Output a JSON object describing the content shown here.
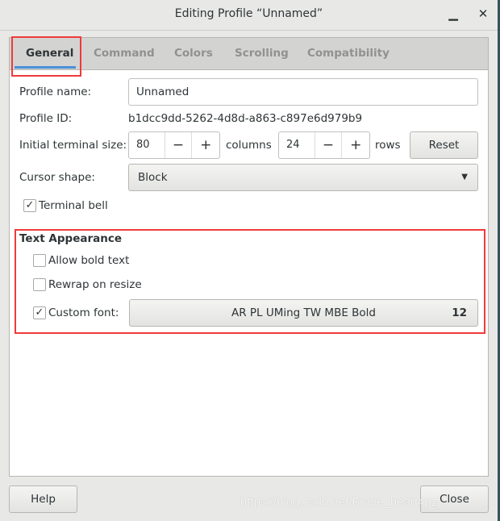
{
  "window": {
    "title": "Editing Profile “Unnamed”",
    "minimize_icon": "minimize-icon",
    "close_icon": "close-icon"
  },
  "tabs": [
    {
      "label": "General",
      "active": true
    },
    {
      "label": "Command"
    },
    {
      "label": "Colors"
    },
    {
      "label": "Scrolling"
    },
    {
      "label": "Compatibility"
    }
  ],
  "general": {
    "profile_name_label": "Profile name:",
    "profile_name_value": "Unnamed",
    "profile_id_label": "Profile ID:",
    "profile_id_value": "b1dcc9dd-5262-4d8d-a863-c897e6d979b9",
    "size_label": "Initial terminal size:",
    "columns_value": "80",
    "columns_label": "columns",
    "rows_value": "24",
    "rows_label": "rows",
    "minus": "−",
    "plus": "+",
    "reset_label": "Reset",
    "cursor_label": "Cursor shape:",
    "cursor_value": "Block",
    "bell_label": "Terminal bell",
    "bell_checked": true
  },
  "text_appearance": {
    "heading": "Text Appearance",
    "bold_label": "Allow bold text",
    "bold_checked": false,
    "rewrap_label": "Rewrap on resize",
    "rewrap_checked": false,
    "custom_font_label": "Custom font:",
    "custom_font_checked": true,
    "font_name": "AR PL UMing TW MBE Bold",
    "font_size": "12"
  },
  "footer": {
    "help_label": "Help",
    "close_label": "Close"
  },
  "watermark": "https://blog.csdn.net/Brave_heart4pzj",
  "colors": {
    "accent": "#4a90d9",
    "highlight": "#f03a3a"
  }
}
